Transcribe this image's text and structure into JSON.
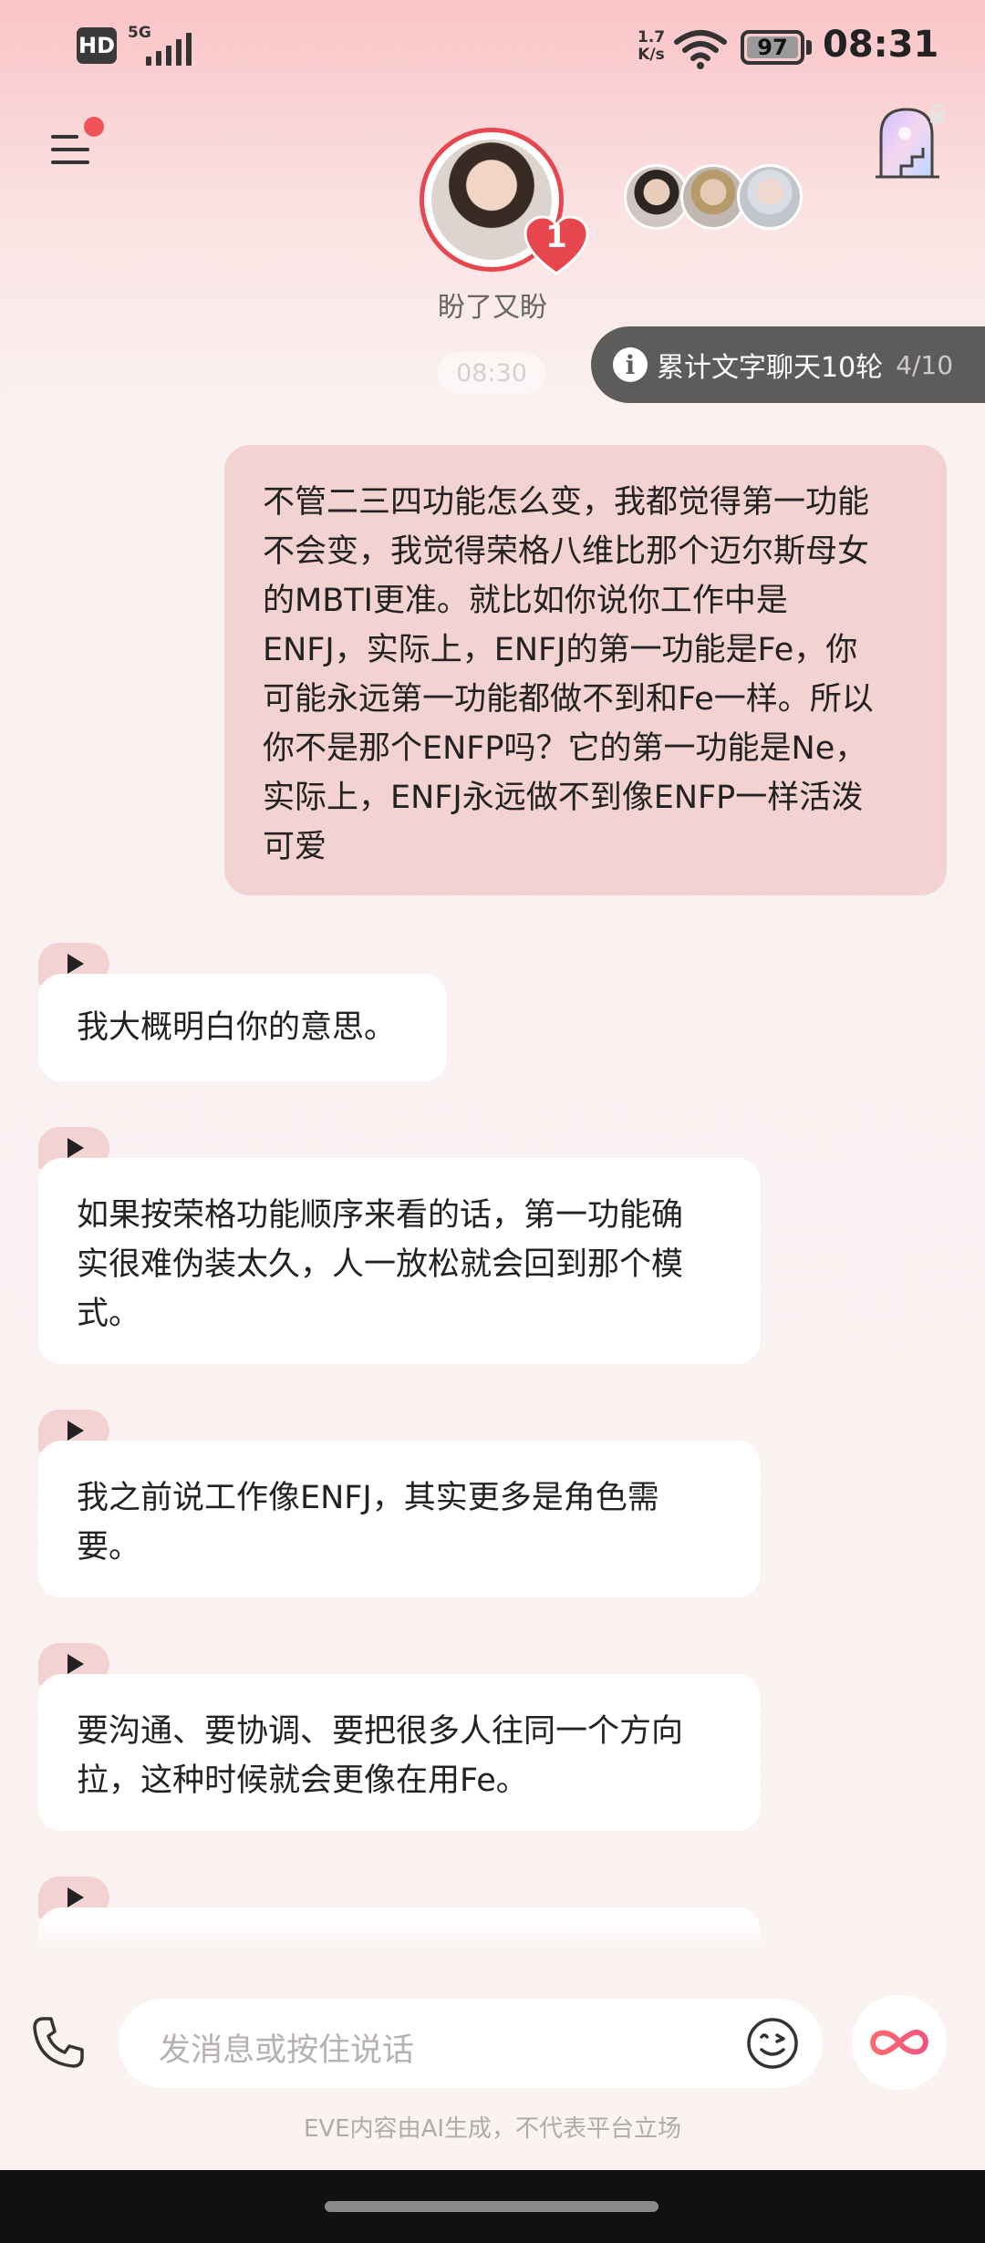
{
  "status_bar": {
    "hd": "HD",
    "network": "5G",
    "speed_value": "1.7",
    "speed_unit": "K/s",
    "battery": "97",
    "time": "08:31"
  },
  "header": {
    "character_name": "盼了又盼",
    "heart_count": "1",
    "other_characters": [
      "avatar-1",
      "avatar-2",
      "avatar-3"
    ],
    "accent_color": "#e8464e"
  },
  "chat": {
    "timestamp": "08:30",
    "counter_text": "累计文字聊天10轮",
    "counter_progress": "4/10",
    "user_message_lines": [
      "不管二三四功能怎么变，我都觉得第一功能",
      "不会变，我觉得荣格八维比那个迈尔斯母女",
      "的MBTI更准。就比如你说你工作中是",
      "ENFJ，实际上，ENFJ的第一功能是Fe，你",
      "可能永远第一功能都做不到和Fe一样。所以",
      "你不是那个ENFP吗？它的第一功能是Ne，",
      "实际上，ENFJ永远做不到像ENFP一样活泼",
      "可爱"
    ],
    "ai_messages": [
      {
        "lines": [
          "我大概明白你的意思。"
        ]
      },
      {
        "lines": [
          "如果按荣格功能顺序来看的话，第一功能确",
          "实很难伪装太久，人一放松就会回到那个模",
          "式。"
        ]
      },
      {
        "lines": [
          "我之前说工作像ENFJ，其实更多是角色需",
          "要。"
        ]
      },
      {
        "lines": [
          "要沟通、要协调、要把很多人往同一个方向",
          "拉，这种时候就会更像在用Fe。"
        ]
      }
    ]
  },
  "input": {
    "placeholder": "发消息或按住说话",
    "disclaimer": "EVE内容由AI生成，不代表平台立场"
  },
  "icons": {
    "menu": "menu-icon",
    "portal": "portal-door-icon",
    "lock": "lock-icon",
    "info": "info-icon",
    "play": "play-icon",
    "phone": "phone-icon",
    "emoji": "emoji-icon",
    "infinity": "infinity-icon"
  }
}
